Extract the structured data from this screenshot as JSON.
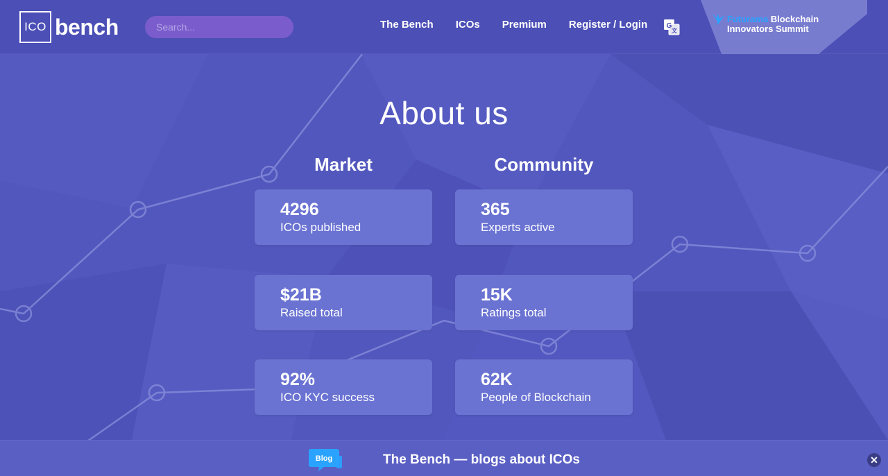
{
  "header": {
    "logo": {
      "box_text": "ICO",
      "word": "bench"
    },
    "search": {
      "placeholder": "Search..."
    },
    "nav": [
      {
        "label": "The Bench"
      },
      {
        "label": "ICOs"
      },
      {
        "label": "Premium"
      },
      {
        "label": "Register / Login"
      }
    ],
    "translate_icon": "google-translate-icon",
    "promo": {
      "line1_accent": "Futurama",
      "line1_rest": " Blockchain",
      "line2": "Innovators Summit",
      "icon": "bird-icon"
    }
  },
  "main": {
    "title": "About us",
    "columns": [
      {
        "title": "Market",
        "stats": [
          {
            "value": "4296",
            "label": "ICOs published"
          },
          {
            "value": "$21B",
            "label": "Raised total"
          },
          {
            "value": "92%",
            "label": "ICO KYC success"
          }
        ]
      },
      {
        "title": "Community",
        "stats": [
          {
            "value": "365",
            "label": "Experts active"
          },
          {
            "value": "15K",
            "label": "Ratings total"
          },
          {
            "value": "62K",
            "label": "People of Blockchain"
          }
        ]
      }
    ]
  },
  "bottom_bar": {
    "blog_icon_text": "Blog",
    "text": "The Bench — blogs about ICOs",
    "close_label": "✕"
  },
  "colors": {
    "background": "#5257bd",
    "header": "#4b4fb6",
    "card": "#6a73d2",
    "accent_blue": "#29a3ff"
  }
}
